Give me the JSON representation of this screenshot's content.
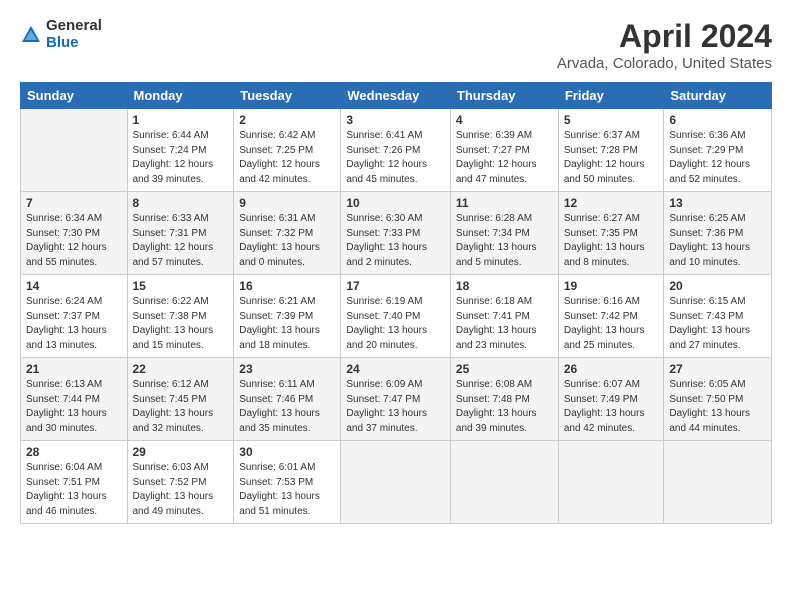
{
  "header": {
    "logo_general": "General",
    "logo_blue": "Blue",
    "title": "April 2024",
    "subtitle": "Arvada, Colorado, United States"
  },
  "days_of_week": [
    "Sunday",
    "Monday",
    "Tuesday",
    "Wednesday",
    "Thursday",
    "Friday",
    "Saturday"
  ],
  "weeks": [
    [
      {
        "num": "",
        "info": ""
      },
      {
        "num": "1",
        "info": "Sunrise: 6:44 AM\nSunset: 7:24 PM\nDaylight: 12 hours\nand 39 minutes."
      },
      {
        "num": "2",
        "info": "Sunrise: 6:42 AM\nSunset: 7:25 PM\nDaylight: 12 hours\nand 42 minutes."
      },
      {
        "num": "3",
        "info": "Sunrise: 6:41 AM\nSunset: 7:26 PM\nDaylight: 12 hours\nand 45 minutes."
      },
      {
        "num": "4",
        "info": "Sunrise: 6:39 AM\nSunset: 7:27 PM\nDaylight: 12 hours\nand 47 minutes."
      },
      {
        "num": "5",
        "info": "Sunrise: 6:37 AM\nSunset: 7:28 PM\nDaylight: 12 hours\nand 50 minutes."
      },
      {
        "num": "6",
        "info": "Sunrise: 6:36 AM\nSunset: 7:29 PM\nDaylight: 12 hours\nand 52 minutes."
      }
    ],
    [
      {
        "num": "7",
        "info": "Sunrise: 6:34 AM\nSunset: 7:30 PM\nDaylight: 12 hours\nand 55 minutes."
      },
      {
        "num": "8",
        "info": "Sunrise: 6:33 AM\nSunset: 7:31 PM\nDaylight: 12 hours\nand 57 minutes."
      },
      {
        "num": "9",
        "info": "Sunrise: 6:31 AM\nSunset: 7:32 PM\nDaylight: 13 hours\nand 0 minutes."
      },
      {
        "num": "10",
        "info": "Sunrise: 6:30 AM\nSunset: 7:33 PM\nDaylight: 13 hours\nand 2 minutes."
      },
      {
        "num": "11",
        "info": "Sunrise: 6:28 AM\nSunset: 7:34 PM\nDaylight: 13 hours\nand 5 minutes."
      },
      {
        "num": "12",
        "info": "Sunrise: 6:27 AM\nSunset: 7:35 PM\nDaylight: 13 hours\nand 8 minutes."
      },
      {
        "num": "13",
        "info": "Sunrise: 6:25 AM\nSunset: 7:36 PM\nDaylight: 13 hours\nand 10 minutes."
      }
    ],
    [
      {
        "num": "14",
        "info": "Sunrise: 6:24 AM\nSunset: 7:37 PM\nDaylight: 13 hours\nand 13 minutes."
      },
      {
        "num": "15",
        "info": "Sunrise: 6:22 AM\nSunset: 7:38 PM\nDaylight: 13 hours\nand 15 minutes."
      },
      {
        "num": "16",
        "info": "Sunrise: 6:21 AM\nSunset: 7:39 PM\nDaylight: 13 hours\nand 18 minutes."
      },
      {
        "num": "17",
        "info": "Sunrise: 6:19 AM\nSunset: 7:40 PM\nDaylight: 13 hours\nand 20 minutes."
      },
      {
        "num": "18",
        "info": "Sunrise: 6:18 AM\nSunset: 7:41 PM\nDaylight: 13 hours\nand 23 minutes."
      },
      {
        "num": "19",
        "info": "Sunrise: 6:16 AM\nSunset: 7:42 PM\nDaylight: 13 hours\nand 25 minutes."
      },
      {
        "num": "20",
        "info": "Sunrise: 6:15 AM\nSunset: 7:43 PM\nDaylight: 13 hours\nand 27 minutes."
      }
    ],
    [
      {
        "num": "21",
        "info": "Sunrise: 6:13 AM\nSunset: 7:44 PM\nDaylight: 13 hours\nand 30 minutes."
      },
      {
        "num": "22",
        "info": "Sunrise: 6:12 AM\nSunset: 7:45 PM\nDaylight: 13 hours\nand 32 minutes."
      },
      {
        "num": "23",
        "info": "Sunrise: 6:11 AM\nSunset: 7:46 PM\nDaylight: 13 hours\nand 35 minutes."
      },
      {
        "num": "24",
        "info": "Sunrise: 6:09 AM\nSunset: 7:47 PM\nDaylight: 13 hours\nand 37 minutes."
      },
      {
        "num": "25",
        "info": "Sunrise: 6:08 AM\nSunset: 7:48 PM\nDaylight: 13 hours\nand 39 minutes."
      },
      {
        "num": "26",
        "info": "Sunrise: 6:07 AM\nSunset: 7:49 PM\nDaylight: 13 hours\nand 42 minutes."
      },
      {
        "num": "27",
        "info": "Sunrise: 6:05 AM\nSunset: 7:50 PM\nDaylight: 13 hours\nand 44 minutes."
      }
    ],
    [
      {
        "num": "28",
        "info": "Sunrise: 6:04 AM\nSunset: 7:51 PM\nDaylight: 13 hours\nand 46 minutes."
      },
      {
        "num": "29",
        "info": "Sunrise: 6:03 AM\nSunset: 7:52 PM\nDaylight: 13 hours\nand 49 minutes."
      },
      {
        "num": "30",
        "info": "Sunrise: 6:01 AM\nSunset: 7:53 PM\nDaylight: 13 hours\nand 51 minutes."
      },
      {
        "num": "",
        "info": ""
      },
      {
        "num": "",
        "info": ""
      },
      {
        "num": "",
        "info": ""
      },
      {
        "num": "",
        "info": ""
      }
    ]
  ]
}
